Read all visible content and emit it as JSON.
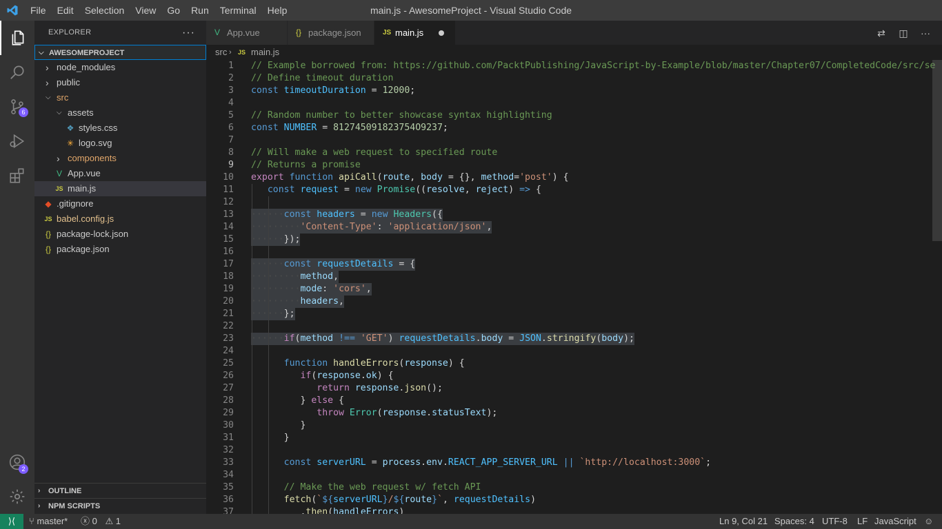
{
  "titlebar": {
    "title": "main.js - AwesomeProject - Visual Studio Code",
    "menu": [
      "File",
      "Edit",
      "Selection",
      "View",
      "Go",
      "Run",
      "Terminal",
      "Help"
    ]
  },
  "activitybar": {
    "source_control_badge": "6",
    "accounts_badge": "2"
  },
  "sidebar": {
    "title": "EXPLORER",
    "project": "AWESOMEPROJECT",
    "tree": [
      {
        "name": "node_modules",
        "depth": 1,
        "type": "folder",
        "open": false,
        "color": "#cccccc"
      },
      {
        "name": "public",
        "depth": 1,
        "type": "folder",
        "open": false,
        "color": "#cccccc"
      },
      {
        "name": "src",
        "depth": 1,
        "type": "folder",
        "open": true,
        "color": "#e2a76a"
      },
      {
        "name": "assets",
        "depth": 2,
        "type": "folder",
        "open": true,
        "color": "#cccccc"
      },
      {
        "name": "styles.css",
        "depth": 3,
        "type": "file",
        "icon": "css",
        "color": "#cccccc"
      },
      {
        "name": "logo.svg",
        "depth": 3,
        "type": "file",
        "icon": "svg",
        "color": "#cccccc"
      },
      {
        "name": "components",
        "depth": 2,
        "type": "folder",
        "open": false,
        "color": "#e2a76a"
      },
      {
        "name": "App.vue",
        "depth": 2,
        "type": "file",
        "icon": "vue",
        "color": "#cccccc"
      },
      {
        "name": "main.js",
        "depth": 2,
        "type": "file",
        "icon": "js",
        "color": "#cccccc",
        "selected": true
      },
      {
        "name": ".gitignore",
        "depth": 1,
        "type": "file",
        "icon": "git",
        "color": "#cccccc"
      },
      {
        "name": "babel.config.js",
        "depth": 1,
        "type": "file",
        "icon": "js",
        "color": "#e2c08d"
      },
      {
        "name": "package-lock.json",
        "depth": 1,
        "type": "file",
        "icon": "json",
        "color": "#cccccc"
      },
      {
        "name": "package.json",
        "depth": 1,
        "type": "file",
        "icon": "json",
        "color": "#cccccc"
      }
    ],
    "outline": "OUTLINE",
    "npm_scripts": "NPM SCRIPTS"
  },
  "tabs": [
    {
      "label": "App.vue",
      "icon": "vue",
      "active": false
    },
    {
      "label": "package.json",
      "icon": "json",
      "active": false
    },
    {
      "label": "main.js",
      "icon": "js",
      "active": true,
      "dirty": true
    }
  ],
  "breadcrumb": {
    "folder": "src",
    "file": "main.js"
  },
  "code": {
    "current_line": 9,
    "lines": [
      [
        [
          "c",
          "// Example borrowed from: https://github.com/PacktPublishing/JavaScript-by-Example/blob/master/Chapter07/CompletedCode/src/se"
        ]
      ],
      [
        [
          "c",
          "// Define timeout duration"
        ]
      ],
      [
        [
          "kd",
          "const "
        ],
        [
          "cst",
          "timeoutDuration"
        ],
        [
          "op",
          " = "
        ],
        [
          "n",
          "12000"
        ],
        [
          "op",
          ";"
        ]
      ],
      [],
      [
        [
          "c",
          "// Random number to better showcase syntax highlighting"
        ]
      ],
      [
        [
          "kd",
          "const "
        ],
        [
          "cst",
          "NUMBER"
        ],
        [
          "op",
          " = "
        ],
        [
          "n",
          "812745091823754O9237"
        ],
        [
          "op",
          ";"
        ]
      ],
      [],
      [
        [
          "c",
          "// Will make a web request to specified route"
        ]
      ],
      [
        [
          "c",
          "// Returns a promise"
        ]
      ],
      [
        [
          "k",
          "export "
        ],
        [
          "kd",
          "function "
        ],
        [
          "f",
          "apiCall"
        ],
        [
          "op",
          "("
        ],
        [
          "v",
          "route"
        ],
        [
          "op",
          ", "
        ],
        [
          "v",
          "body"
        ],
        [
          "op",
          " = {}, "
        ],
        [
          "v",
          "method"
        ],
        [
          "op",
          "="
        ],
        [
          "s",
          "'post'"
        ],
        [
          "op",
          ") {"
        ]
      ],
      [
        [
          "op",
          "   "
        ],
        [
          "kd",
          "const "
        ],
        [
          "cst",
          "request"
        ],
        [
          "op",
          " = "
        ],
        [
          "kd",
          "new "
        ],
        [
          "t",
          "Promise"
        ],
        [
          "op",
          "(("
        ],
        [
          "v",
          "resolve"
        ],
        [
          "op",
          ", "
        ],
        [
          "v",
          "reject"
        ],
        [
          "op",
          ") "
        ],
        [
          "kd",
          "=>"
        ],
        [
          "op",
          " {"
        ]
      ],
      [],
      [
        [
          "ws",
          "······"
        ],
        [
          "kd",
          "const "
        ],
        [
          "cst",
          "headers"
        ],
        [
          "op",
          " = "
        ],
        [
          "kd",
          "new "
        ],
        [
          "t",
          "Headers"
        ],
        [
          "op",
          "({"
        ]
      ],
      [
        [
          "ws",
          "·········"
        ],
        [
          "s",
          "'Content-Type'"
        ],
        [
          "op",
          ": "
        ],
        [
          "s",
          "'application/json'"
        ],
        [
          "op",
          ","
        ]
      ],
      [
        [
          "ws",
          "······"
        ],
        [
          "op",
          "});"
        ]
      ],
      [],
      [
        [
          "ws",
          "······"
        ],
        [
          "kd",
          "const "
        ],
        [
          "cst",
          "requestDetails"
        ],
        [
          "op",
          " = {"
        ]
      ],
      [
        [
          "ws",
          "·········"
        ],
        [
          "v",
          "method"
        ],
        [
          "op",
          ","
        ]
      ],
      [
        [
          "ws",
          "·········"
        ],
        [
          "v",
          "mode"
        ],
        [
          "op",
          ": "
        ],
        [
          "s",
          "'cors'"
        ],
        [
          "op",
          ","
        ]
      ],
      [
        [
          "ws",
          "·········"
        ],
        [
          "v",
          "headers"
        ],
        [
          "op",
          ","
        ]
      ],
      [
        [
          "ws",
          "······"
        ],
        [
          "op",
          "};"
        ]
      ],
      [],
      [
        [
          "ws",
          "······"
        ],
        [
          "k",
          "if"
        ],
        [
          "op",
          "("
        ],
        [
          "v",
          "method"
        ],
        [
          "op",
          " "
        ],
        [
          "kd",
          "!=="
        ],
        [
          "op",
          " "
        ],
        [
          "s",
          "'GET'"
        ],
        [
          "op",
          ") "
        ],
        [
          "cst",
          "requestDetails"
        ],
        [
          "op",
          "."
        ],
        [
          "v",
          "body"
        ],
        [
          "op",
          " = "
        ],
        [
          "cst",
          "JSON"
        ],
        [
          "op",
          "."
        ],
        [
          "f",
          "stringify"
        ],
        [
          "op",
          "("
        ],
        [
          "v",
          "body"
        ],
        [
          "op",
          ");"
        ]
      ],
      [],
      [
        [
          "op",
          "      "
        ],
        [
          "kd",
          "function "
        ],
        [
          "f",
          "handleErrors"
        ],
        [
          "op",
          "("
        ],
        [
          "v",
          "response"
        ],
        [
          "op",
          ") {"
        ]
      ],
      [
        [
          "op",
          "         "
        ],
        [
          "k",
          "if"
        ],
        [
          "op",
          "("
        ],
        [
          "v",
          "response"
        ],
        [
          "op",
          "."
        ],
        [
          "v",
          "ok"
        ],
        [
          "op",
          ") {"
        ]
      ],
      [
        [
          "op",
          "            "
        ],
        [
          "k",
          "return "
        ],
        [
          "v",
          "response"
        ],
        [
          "op",
          "."
        ],
        [
          "f",
          "json"
        ],
        [
          "op",
          "();"
        ]
      ],
      [
        [
          "op",
          "         } "
        ],
        [
          "k",
          "else"
        ],
        [
          "op",
          " {"
        ]
      ],
      [
        [
          "op",
          "            "
        ],
        [
          "k",
          "throw "
        ],
        [
          "t",
          "Error"
        ],
        [
          "op",
          "("
        ],
        [
          "v",
          "response"
        ],
        [
          "op",
          "."
        ],
        [
          "v",
          "statusText"
        ],
        [
          "op",
          ");"
        ]
      ],
      [
        [
          "op",
          "         }"
        ]
      ],
      [
        [
          "op",
          "      }"
        ]
      ],
      [],
      [
        [
          "op",
          "      "
        ],
        [
          "kd",
          "const "
        ],
        [
          "cst",
          "serverURL"
        ],
        [
          "op",
          " = "
        ],
        [
          "v",
          "process"
        ],
        [
          "op",
          "."
        ],
        [
          "v",
          "env"
        ],
        [
          "op",
          "."
        ],
        [
          "cst",
          "REACT_APP_SERVER_URL"
        ],
        [
          "op",
          " "
        ],
        [
          "kd",
          "||"
        ],
        [
          "op",
          " "
        ],
        [
          "s",
          "`http://localhost:3000`"
        ],
        [
          "op",
          ";"
        ]
      ],
      [],
      [
        [
          "op",
          "      "
        ],
        [
          "c",
          "// Make the web request w/ fetch API"
        ]
      ],
      [
        [
          "op",
          "      "
        ],
        [
          "f",
          "fetch"
        ],
        [
          "op",
          "("
        ],
        [
          "s",
          "`"
        ],
        [
          "kd",
          "${"
        ],
        [
          "cst",
          "serverURL"
        ],
        [
          "kd",
          "}"
        ],
        [
          "s",
          "/"
        ],
        [
          "kd",
          "${"
        ],
        [
          "v",
          "route"
        ],
        [
          "kd",
          "}"
        ],
        [
          "s",
          "`"
        ],
        [
          "op",
          ", "
        ],
        [
          "cst",
          "requestDetails"
        ],
        [
          "op",
          ")"
        ]
      ],
      [
        [
          "op",
          "         ."
        ],
        [
          "f",
          "then"
        ],
        [
          "op",
          "("
        ],
        [
          "v",
          "handleErrors"
        ],
        [
          "op",
          ")"
        ]
      ]
    ]
  },
  "statusbar": {
    "branch": "master*",
    "errors": "0",
    "warnings": "1",
    "position": "Ln 9, Col 21",
    "spaces": "Spaces: 4",
    "encoding": "UTF-8",
    "eol": "LF",
    "language": "JavaScript"
  }
}
